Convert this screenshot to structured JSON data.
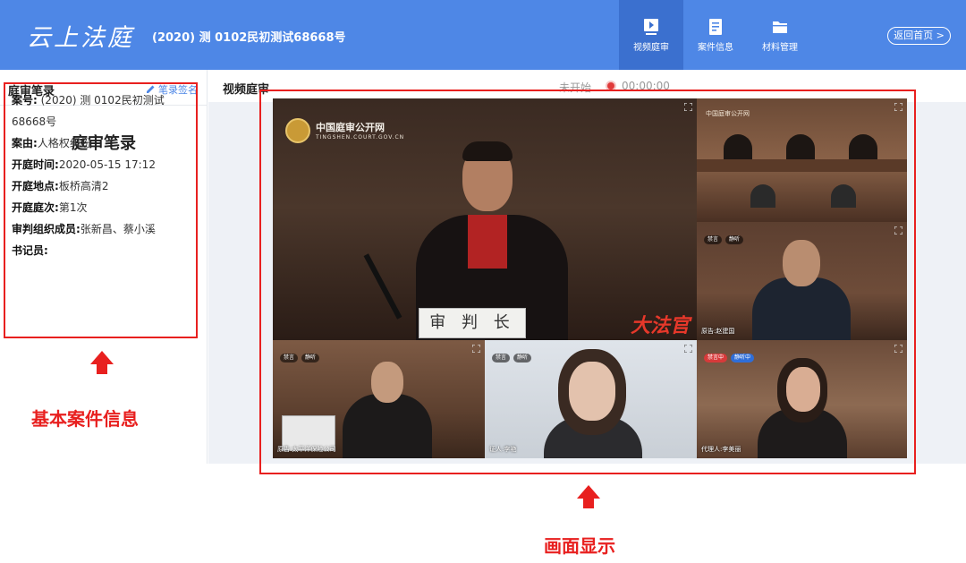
{
  "header": {
    "logo": "云上法庭",
    "case_title": "(2020) 测 0102民初测试68668号",
    "nav": [
      {
        "label": "视频庭审",
        "icon": "play-icon",
        "active": true
      },
      {
        "label": "案件信息",
        "icon": "document-icon",
        "active": false
      },
      {
        "label": "材料管理",
        "icon": "folder-icon",
        "active": false
      }
    ],
    "home_button": "返回首页 >"
  },
  "left_panel": {
    "title": "庭审笔录",
    "sign_link": "笔录签名",
    "record_title": "庭审笔录",
    "info": [
      {
        "label": "案号:",
        "value": " (2020) 测 0102民初测试"
      },
      {
        "label": "",
        "value": "68668号"
      },
      {
        "label": "案由:",
        "value": "人格权纠纷"
      },
      {
        "label": "开庭时间:",
        "value": "2020-05-15 17:12"
      },
      {
        "label": "开庭地点:",
        "value": "板桥高清2"
      },
      {
        "label": "开庭庭次:",
        "value": "第1次"
      },
      {
        "label": "审判组织成员:",
        "value": "张新昌、蔡小溪"
      },
      {
        "label": "书记员:",
        "value": ""
      }
    ],
    "callout": "基本案件信息"
  },
  "main_panel": {
    "title": "视频庭审",
    "status": "未开始",
    "time": "00:00:00",
    "callout": "画面显示"
  },
  "video": {
    "gov_name": "中国庭审公开网",
    "gov_url": "TINGSHEN.COURT.GOV.CN",
    "nameplate": "审 判 长",
    "watermark": "大法官",
    "controls": {
      "mute": "禁言",
      "silence": "静听",
      "muted": "禁言中",
      "silenced": "静听中"
    },
    "tiles": {
      "r2": "原告:赵建国",
      "b1": "原告:太平洋保险公司",
      "b2": "证人:李艳",
      "b3": "代理人:李美丽"
    }
  },
  "colors": {
    "header_bg": "#4e87e6",
    "annotation_red": "#e8201f"
  }
}
